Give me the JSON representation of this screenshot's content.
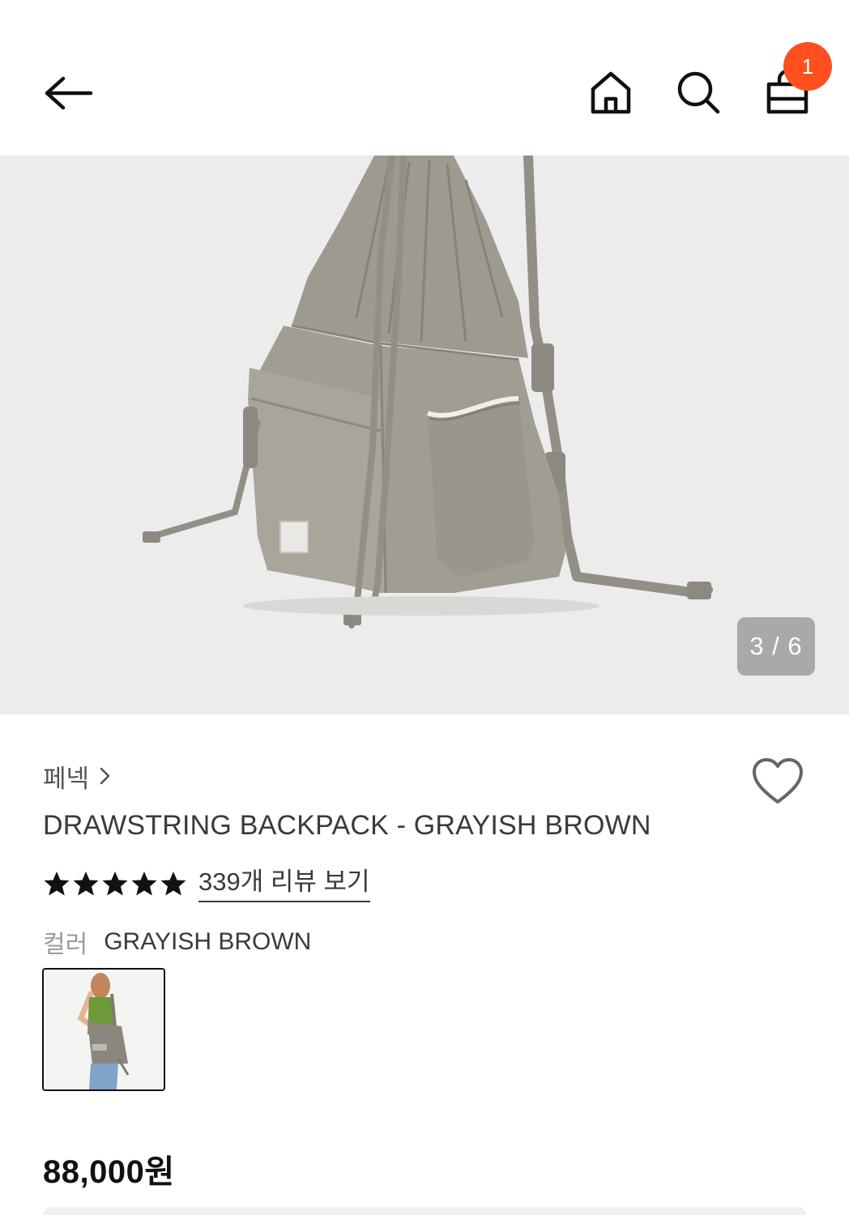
{
  "header": {
    "back_icon": "arrow-left-icon",
    "home_icon": "home-icon",
    "search_icon": "search-icon",
    "cart_icon": "shopping-bag-icon",
    "cart_count": "1",
    "badge_color": "#ff4f1f"
  },
  "gallery": {
    "counter": "3 / 6",
    "current": 3,
    "total": 6
  },
  "product": {
    "brand": "페넥",
    "title": "DRAWSTRING BACKPACK - GRAYISH BROWN",
    "rating_stars": 5,
    "review_link": "339개 리뷰 보기",
    "color_label": "컬러",
    "color_value": "GRAYISH BROWN",
    "price": "88,000원"
  }
}
